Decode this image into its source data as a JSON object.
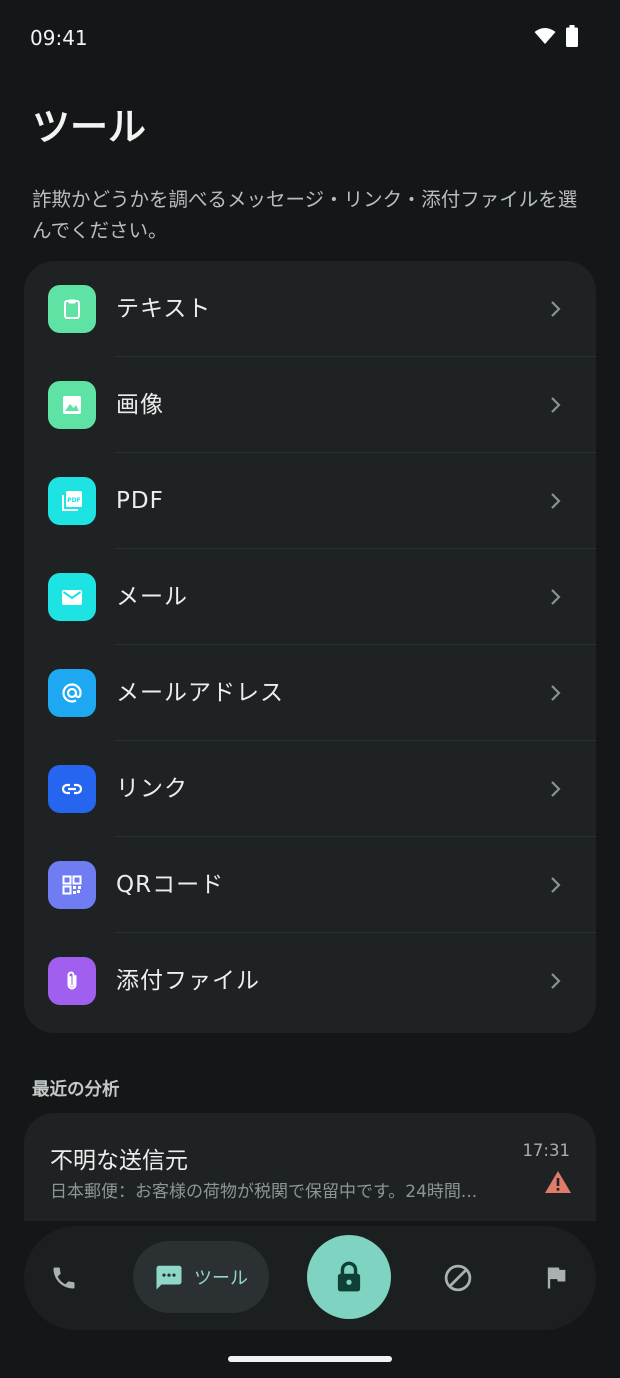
{
  "status_bar": {
    "time": "09:41"
  },
  "header": {
    "title": "ツール",
    "description": "詐欺かどうかを調べるメッセージ・リンク・添付ファイルを選んでください。"
  },
  "tools": [
    {
      "label": "テキスト",
      "icon": "clipboard-icon",
      "color": "#5fe3a4"
    },
    {
      "label": "画像",
      "icon": "image-icon",
      "color": "#5fe3a4"
    },
    {
      "label": "PDF",
      "icon": "pdf-icon",
      "color": "#1ee3e3"
    },
    {
      "label": "メール",
      "icon": "mail-icon",
      "color": "#1ee3e3"
    },
    {
      "label": "メールアドレス",
      "icon": "at-sign-icon",
      "color": "#1fa8f2"
    },
    {
      "label": "リンク",
      "icon": "link-icon",
      "color": "#2565f0"
    },
    {
      "label": "QRコード",
      "icon": "qr-code-icon",
      "color": "#6f7cf2"
    },
    {
      "label": "添付ファイル",
      "icon": "paperclip-icon",
      "color": "#a15ff0"
    }
  ],
  "recent": {
    "section_title": "最近の分析",
    "items": [
      {
        "sender": "不明な送信元",
        "preview": "日本郵便：お客様の荷物が税関で保留中です。24時間...",
        "time": "17:31",
        "status_icon": "warning-icon",
        "status_color": "#e07a6a"
      }
    ]
  },
  "bottom_nav": {
    "items": [
      {
        "icon": "phone-icon"
      },
      {
        "icon": "chat-icon",
        "label": "ツール",
        "active": true
      },
      {
        "icon": "lock-icon",
        "primary": true
      },
      {
        "icon": "block-icon"
      },
      {
        "icon": "flag-icon"
      }
    ]
  },
  "colors": {
    "background": "#141718",
    "card": "#1e2223",
    "accent": "#7fd3c1"
  }
}
